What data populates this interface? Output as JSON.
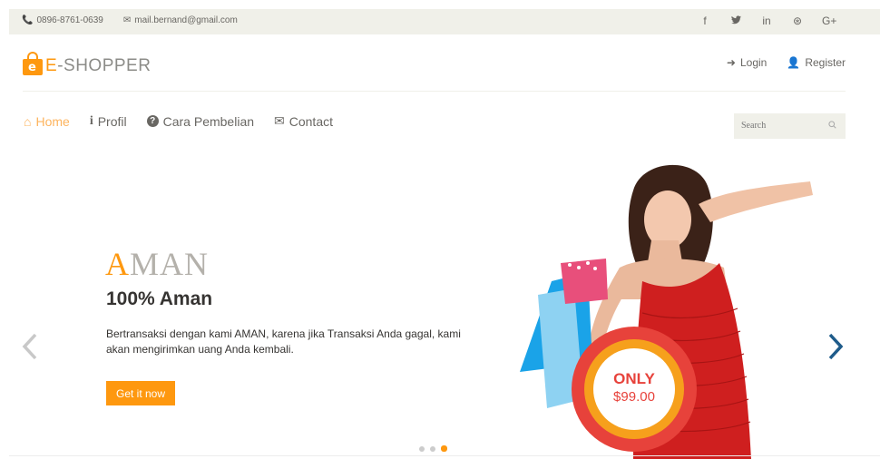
{
  "topbar": {
    "phone": "0896-8761-0639",
    "email": "mail.bernand@gmail.com",
    "social": [
      {
        "icon": "facebook-icon",
        "glyph": "f"
      },
      {
        "icon": "twitter-icon",
        "glyph": "🐦"
      },
      {
        "icon": "linkedin-icon",
        "glyph": "in"
      },
      {
        "icon": "dribbble-icon",
        "glyph": "⊛"
      },
      {
        "icon": "google-plus-icon",
        "glyph": "G+"
      }
    ]
  },
  "logo": {
    "first_letter": "E",
    "rest": "-SHOPPER"
  },
  "account": {
    "login": "Login",
    "register": "Register"
  },
  "nav": {
    "items": [
      {
        "label": "Home",
        "icon": "home-icon",
        "glyph": "🏠",
        "active": true
      },
      {
        "label": "Profil",
        "icon": "info-icon",
        "glyph": "i",
        "active": false
      },
      {
        "label": "Cara Pembelian",
        "icon": "question-icon",
        "glyph": "?",
        "active": false
      },
      {
        "label": "Contact",
        "icon": "envelope-icon",
        "glyph": "✉",
        "active": false
      }
    ]
  },
  "search": {
    "placeholder": "Search"
  },
  "slide": {
    "headline_first": "A",
    "headline_rest": "MAN",
    "subheadline": "100% Aman",
    "description": "Bertransaksi dengan kami AMAN, karena jika Transaksi Anda gagal, kami akan mengirimkan uang Anda kembali.",
    "cta": "Get it now",
    "badge_label": "ONLY",
    "badge_price": "$99.00",
    "active_dot": 3,
    "total_dots": 3
  },
  "colors": {
    "accent": "#fe980f",
    "topbar_bg": "#f0f0e9",
    "arrow_blue": "#1e5b8a",
    "badge_red": "#e7423b"
  }
}
